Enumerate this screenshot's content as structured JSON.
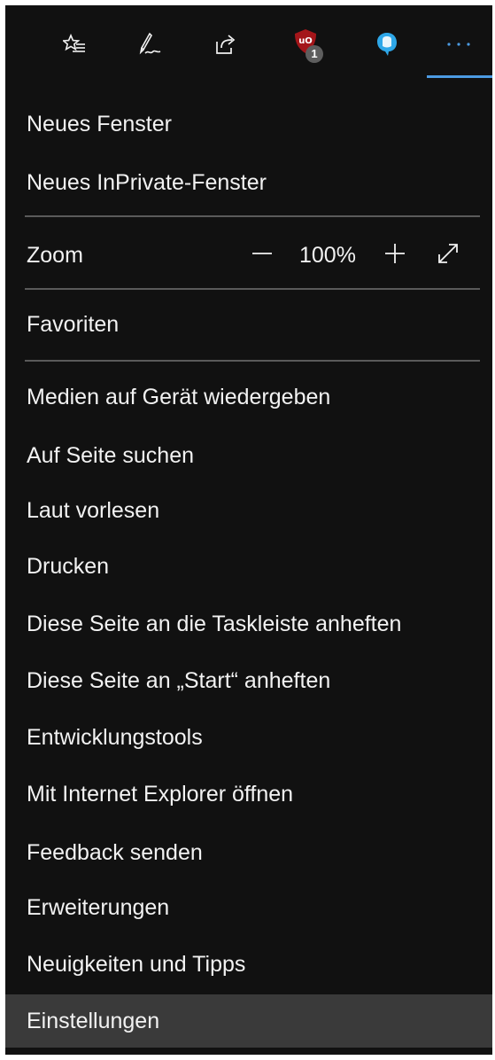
{
  "toolbar": {
    "icons": {
      "favorites": "favorites-list-star-icon",
      "notes": "pen-notes-icon",
      "share": "share-icon",
      "ublock": "ublock-origin-shield-icon",
      "extension": "blue-bubble-extension-icon",
      "more": "more-dots-icon"
    },
    "ublock_badge": "1"
  },
  "menu": {
    "new_window": "Neues Fenster",
    "new_inprivate": "Neues InPrivate-Fenster",
    "zoom_label": "Zoom",
    "zoom_value": "100%",
    "favorites": "Favoriten",
    "items": [
      "Medien auf Gerät wiedergeben",
      "Auf Seite suchen",
      "Laut vorlesen",
      "Drucken",
      "Diese Seite an die Taskleiste anheften",
      "Diese Seite an „Start“ anheften",
      "Entwicklungstools",
      "Mit Internet Explorer öffnen",
      "Feedback senden",
      "Erweiterungen",
      "Neuigkeiten und Tipps",
      "Einstellungen"
    ],
    "highlighted_index": 11
  },
  "colors": {
    "background": "#111111",
    "text": "#f2f2f2",
    "separator": "#5a5a5a",
    "accent": "#4c9be3",
    "hover": "#3a3a3a",
    "ublock_red": "#a4161a"
  }
}
